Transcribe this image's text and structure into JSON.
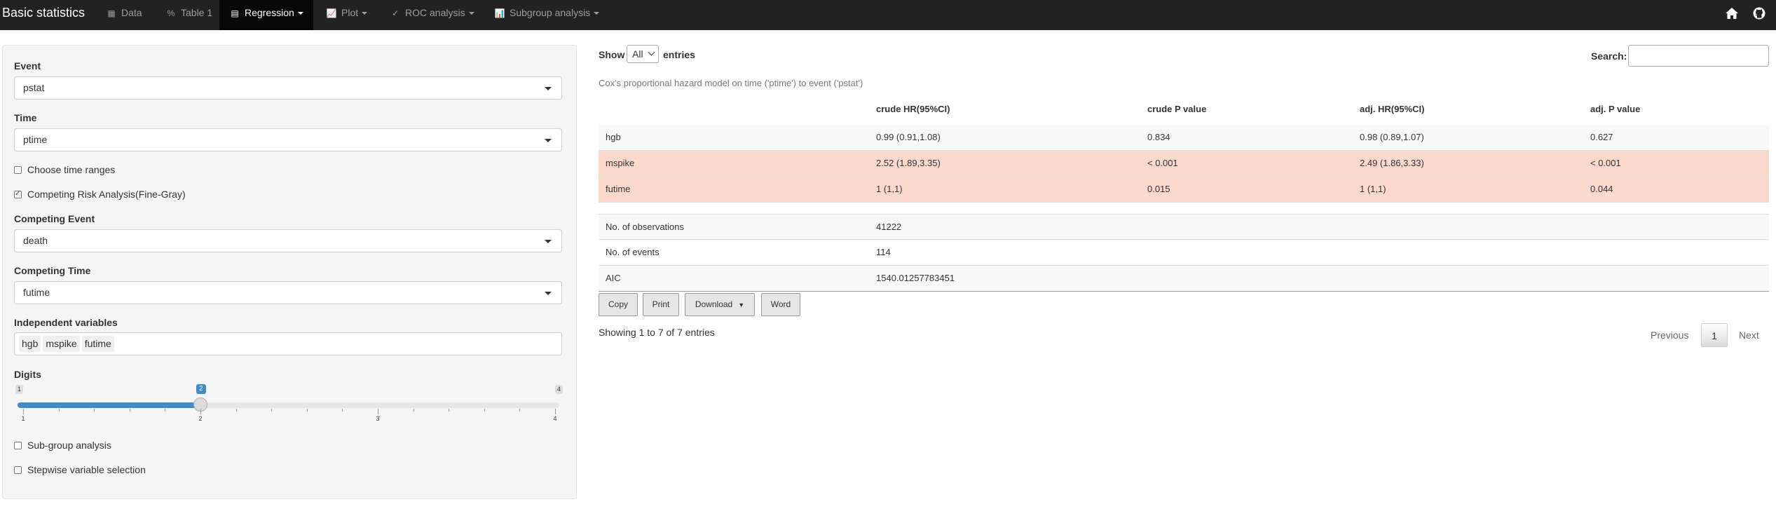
{
  "navbar": {
    "brand": "Basic statistics",
    "items": [
      {
        "label": "Data",
        "icon": "table-icon"
      },
      {
        "label": "Table 1",
        "icon": "percent-icon"
      },
      {
        "label": "Regression",
        "icon": "list-alt-icon"
      },
      {
        "label": "Plot",
        "icon": "bar-chart-icon"
      },
      {
        "label": "ROC analysis",
        "icon": "check-icon"
      },
      {
        "label": "Subgroup analysis",
        "icon": "bar-chart-icon"
      }
    ],
    "active": "Regression",
    "right_icons": [
      "home-icon",
      "github-icon"
    ]
  },
  "sidebar": {
    "event": {
      "label": "Event",
      "value": "pstat"
    },
    "time": {
      "label": "Time",
      "value": "ptime"
    },
    "choose_time_ranges": {
      "label": "Choose time ranges",
      "checked": false
    },
    "competing_risk": {
      "label": "Competing Risk Analysis(Fine-Gray)",
      "checked": true
    },
    "competing_event": {
      "label": "Competing Event",
      "value": "death"
    },
    "competing_time": {
      "label": "Competing Time",
      "value": "futime"
    },
    "independent": {
      "label": "Independent variables",
      "tags": [
        "hgb",
        "mspike",
        "futime"
      ]
    },
    "digits": {
      "label": "Digits",
      "min": "1",
      "max": "4",
      "value": "2",
      "ticks": [
        "1",
        "2",
        "3",
        "4"
      ]
    },
    "subgroup": {
      "label": "Sub-group analysis",
      "checked": false
    },
    "stepwise": {
      "label": "Stepwise variable selection",
      "checked": false
    }
  },
  "main": {
    "show_label": "Show",
    "show_value": "All",
    "entries_label": "entries",
    "search_label": "Search:",
    "caption": "Cox's proportional hazard model on time ('ptime') to event ('pstat')",
    "headers": [
      "",
      "crude HR(95%CI)",
      "crude P value",
      "adj. HR(95%CI)",
      "adj. P value"
    ],
    "rows": [
      {
        "cells": [
          "hgb",
          "0.99 (0.91,1.08)",
          "0.834",
          "0.98 (0.89,1.07)",
          "0.627"
        ],
        "highlight": false
      },
      {
        "cells": [
          "mspike",
          "2.52 (1.89,3.35)",
          "< 0.001",
          "2.49 (1.86,3.33)",
          "< 0.001"
        ],
        "highlight": true
      },
      {
        "cells": [
          "futime",
          "1 (1,1)",
          "0.015",
          "1 (1,1)",
          "0.044"
        ],
        "highlight": true
      }
    ],
    "summary_rows": [
      {
        "cells": [
          "No. of observations",
          "41222"
        ]
      },
      {
        "cells": [
          "No. of events",
          "114"
        ]
      },
      {
        "cells": [
          "AIC",
          "1540.01257783451"
        ]
      }
    ],
    "buttons": [
      "Copy",
      "Print",
      "Download",
      "Word"
    ],
    "info": "Showing 1 to 7 of 7 entries",
    "pagination": {
      "previous": "Previous",
      "current": "1",
      "next": "Next"
    }
  },
  "colors": {
    "navbar": "#222222",
    "highlight_row": "#fcd9cd",
    "slider": "#428bca"
  }
}
